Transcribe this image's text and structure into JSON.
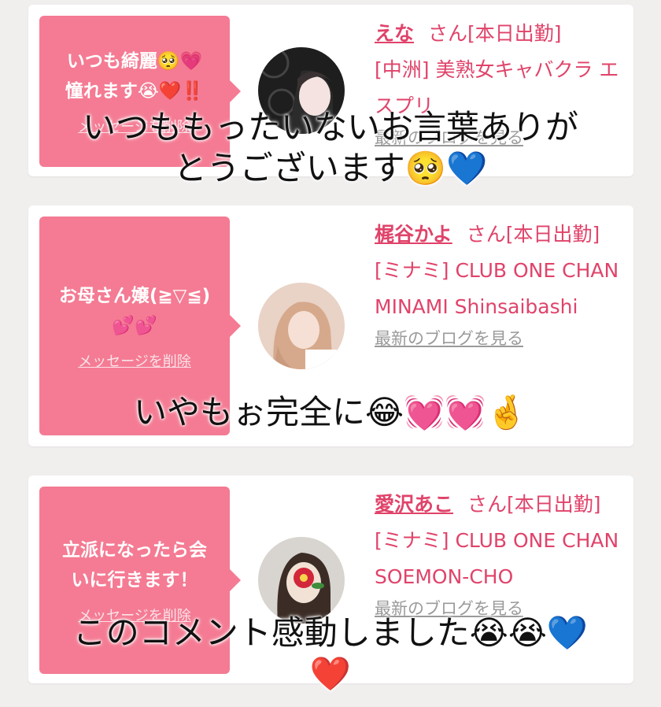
{
  "cards": [
    {
      "message": "いつも綺麗🥺💗\n憧れます😭❤️‼️",
      "delete_label": "メッセージを削除",
      "name": "えな",
      "san": "さん[本日出勤]",
      "shop": "[中洲] 美熟女キャバクラ エスプリ",
      "blog": "最新のブログを見る",
      "avatar_colors": [
        "#2a2a2a",
        "#f4e3e1"
      ]
    },
    {
      "message": "お母さん嬢(≧▽≦)\n💕💕",
      "delete_label": "メッセージを削除",
      "name": "梶谷かよ",
      "san": "さん[本日出勤]",
      "shop": "[ミナミ] CLUB ONE CHAN MINAMI Shinsaibashi",
      "blog": "最新のブログを見る",
      "avatar_colors": [
        "#d9b39a",
        "#f4ddd2"
      ]
    },
    {
      "message": "立派になったら会\nいに行きます！",
      "delete_label": "メッセージを削除",
      "name": "愛沢あこ",
      "san": "さん[本日出勤]",
      "shop": "[ミナミ] CLUB ONE CHAN SOEMON-CHO",
      "blog": "最新のブログを見る",
      "avatar_colors": [
        "#3b2c26",
        "#f2e2d6"
      ]
    }
  ],
  "captions": {
    "top": "いつももったいないお言葉ありが\nとうございます🥺💙",
    "middle": "いやもぉ完全に😂💓💓🤞",
    "bottom": "このコメント感動しました😭😭💙\n❤️"
  }
}
